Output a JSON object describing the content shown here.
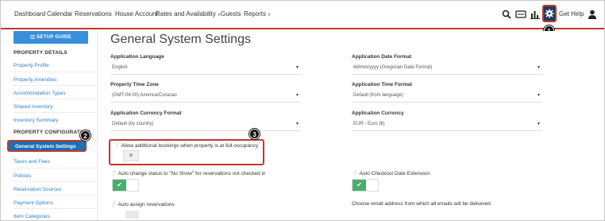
{
  "topnav": {
    "items": [
      "Dashboard",
      "Calendar",
      "Reservations",
      "House Account",
      "Rates and Availability",
      "Guests",
      "Reports"
    ],
    "get_help": "Get Help"
  },
  "markers": [
    "1",
    "2",
    "3"
  ],
  "sidebar": {
    "setup_guide": "SETUP GUIDE",
    "section1": "PROPERTY DETAILS",
    "items1": [
      "Property Profile",
      "Property Amenities",
      "Accommodation Types",
      "Shared Inventory",
      "Inventory Summary"
    ],
    "section2": "PROPERTY CONFIGURATION",
    "active": "General System Settings",
    "items2": [
      "Taxes and Fees",
      "Policies",
      "Reservation Sources",
      "Payment Options",
      "Item Categories"
    ]
  },
  "main": {
    "title": "General System Settings",
    "fields": {
      "app_language": {
        "label": "Application Language",
        "value": "English"
      },
      "app_date_format": {
        "label": "Application Date Format",
        "value": "dd/mm/yyyy (Gregorian Date Format)"
      },
      "time_zone": {
        "label": "Property Time Zone",
        "value": "(GMT-04:00) America/Curacao"
      },
      "time_format": {
        "label": "Application Time Format",
        "value": "Default (from language)"
      },
      "currency_format": {
        "label": "Application Currency Format",
        "value": "Default (by country)"
      },
      "currency": {
        "label": "Application Currency",
        "value": "EUR - Euro (€)"
      }
    },
    "allow_bookings_label": "Allow additional bookings when property is at full occupancy",
    "allow_bookings_value": "⊘",
    "auto_noshow_label": "Auto change status to \"No Show\" for reservations not checked in",
    "auto_checkout_label": "Auto Checkout Date Extension",
    "auto_assign_label": "Auto assign reservations",
    "email_label": "Choose email address from which all emails will be delivered"
  },
  "colors": {
    "accent_red": "#c0392b",
    "sidebar_active": "#1a6fb7",
    "link_blue": "#2f80c9",
    "toggle_green": "#4cae6b",
    "setup_blue": "#3a8fd9"
  },
  "icons": [
    "search-icon",
    "card-icon",
    "chart-icon",
    "gear-icon",
    "user-icon",
    "book-icon",
    "check-icon"
  ]
}
